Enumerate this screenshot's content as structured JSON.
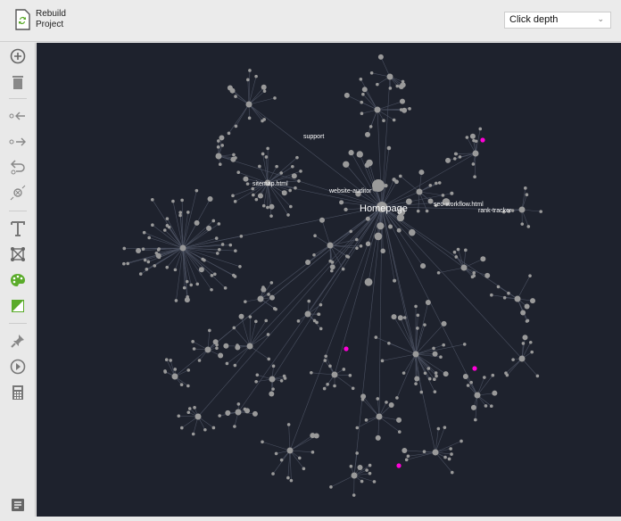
{
  "toolbar": {
    "rebuild_label_1": "Rebuild",
    "rebuild_label_2": "Project",
    "view_select": "Click depth"
  },
  "sidebar": {
    "tools": [
      "add-node",
      "delete",
      "incoming-links",
      "outgoing-links",
      "undo",
      "hide-node",
      "text",
      "layout",
      "color-palette",
      "contrast",
      "pin",
      "play",
      "calculator",
      "report"
    ]
  },
  "graph": {
    "labels": {
      "homepage": "Homepage",
      "sitemap": "sitemap.html",
      "support": "support",
      "website_auditor": "website-auditor",
      "seo_workflow": "seo-workflow.html",
      "rank_tracker": "rank-tracker"
    },
    "colors": {
      "background": "#1e222d",
      "node": "#9a9a9a",
      "edge": "#4a5060",
      "highlight": "#ff00d8",
      "accent": "#5aab2a"
    }
  }
}
